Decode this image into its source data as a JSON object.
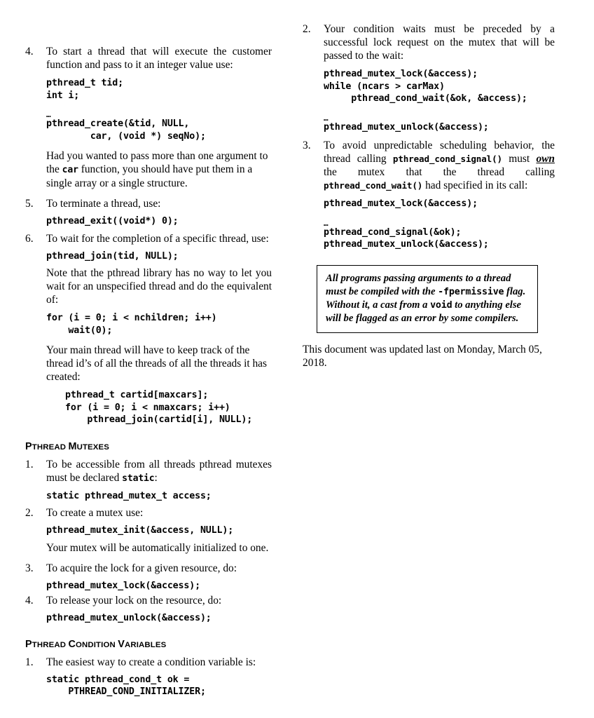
{
  "document": {
    "left_column": {
      "items": [
        {
          "number": "4.",
          "text": "To start a thread that will execute the customer function and pass to it an integer value use:",
          "code": "pthread_t tid;\nint i;",
          "ellipsis": "…",
          "code2": "pthread_create(&tid, NULL,\n        car, (void *) seqNo);",
          "note_a": "Had you wanted to pass more than one argument to the ",
          "note_code": "car",
          "note_b": " function, you should have put them in a single array or a single structure."
        },
        {
          "number": "5.",
          "text": "To terminate a thread, use:",
          "code": "pthread_exit((void*) 0);"
        },
        {
          "number": "6.",
          "text": "To wait for the completion of a specific thread, use:",
          "code": "pthread_join(tid, NULL);",
          "note": "Note that the pthread library has no way to let you wait for an unspecified thread and do the equivalent of:",
          "code2": "for (i = 0; i < nchildren; i++)\n    wait(0);",
          "note2": "Your main thread will have to keep track of the thread id’s of all the threads of all the threads it has created:",
          "code3": "pthread_t cartid[maxcars];\nfor (i = 0; i < nmaxcars; i++)\n    pthread_join(cartid[i], NULL);"
        }
      ],
      "mutex_heading": {
        "word1_cap": "P",
        "word1_rest": "THREAD",
        "word2_cap": "M",
        "word2_rest": "UTEXES"
      },
      "mutex_items": [
        {
          "number": "1.",
          "text_a": "To be accessible from all threads pthread mutexes must be declared ",
          "text_code": "static",
          "text_b": ":",
          "code": "static pthread_mutex_t access;"
        },
        {
          "number": "2.",
          "text": "To create a mutex use:",
          "code": "pthread_mutex_init(&access, NULL);",
          "note": "Your mutex will be automatically initialized to one."
        },
        {
          "number": "3.",
          "text": "To acquire the lock for a given resource, do:",
          "code": "pthread_mutex_lock(&access);"
        },
        {
          "number": "4.",
          "text": "To release your lock on the resource, do:",
          "code": "pthread_mutex_unlock(&access);"
        }
      ],
      "cond_heading": {
        "word1_cap": "P",
        "word1_rest": "THREAD",
        "word2_cap": "C",
        "word2_rest": "ONDITION",
        "word3_cap": "V",
        "word3_rest": "ARIABLES"
      },
      "cond_items": [
        {
          "number": "1.",
          "text": "The easiest way to create a condition variable is:",
          "code": "static pthread_cond_t ok =\n    PTHREAD_COND_INITIALIZER;"
        }
      ]
    },
    "right_column": {
      "items": [
        {
          "number": "2.",
          "text": "Your condition waits must be preceded by a successful lock request on the mutex that will be passed to the wait:",
          "code": "pthread_mutex_lock(&access);\nwhile (ncars > carMax)\n     pthread_cond_wait(&ok, &access);",
          "ellipsis": "…",
          "code2": "pthread_mutex_unlock(&access);"
        },
        {
          "number": "3.",
          "text_a": "To avoid unpredictable scheduling behavior, the thread calling ",
          "code_a": "pthread_cond_signal()",
          "text_b": " must ",
          "emph": "own",
          "text_c": " the mutex that the thread calling ",
          "code_b": "pthread_cond_wait()",
          "text_d": " had specified in its call:",
          "code": "pthread_mutex_lock(&access);",
          "ellipsis": "…",
          "code2": "pthread_cond_signal(&ok);\npthread_mutex_unlock(&access);"
        }
      ],
      "note_box": {
        "line1_a": "All programs passing arguments to a thread must be compiled with the ",
        "line1_code": "-fpermissive",
        "line1_b": " flag.",
        "line2_a": "Without it, a cast from a ",
        "line2_code": "void",
        "line2_b": " to anything else will be flagged as an error by some compilers."
      },
      "footer": "This document was updated last on Monday, March 05, 2018."
    }
  }
}
